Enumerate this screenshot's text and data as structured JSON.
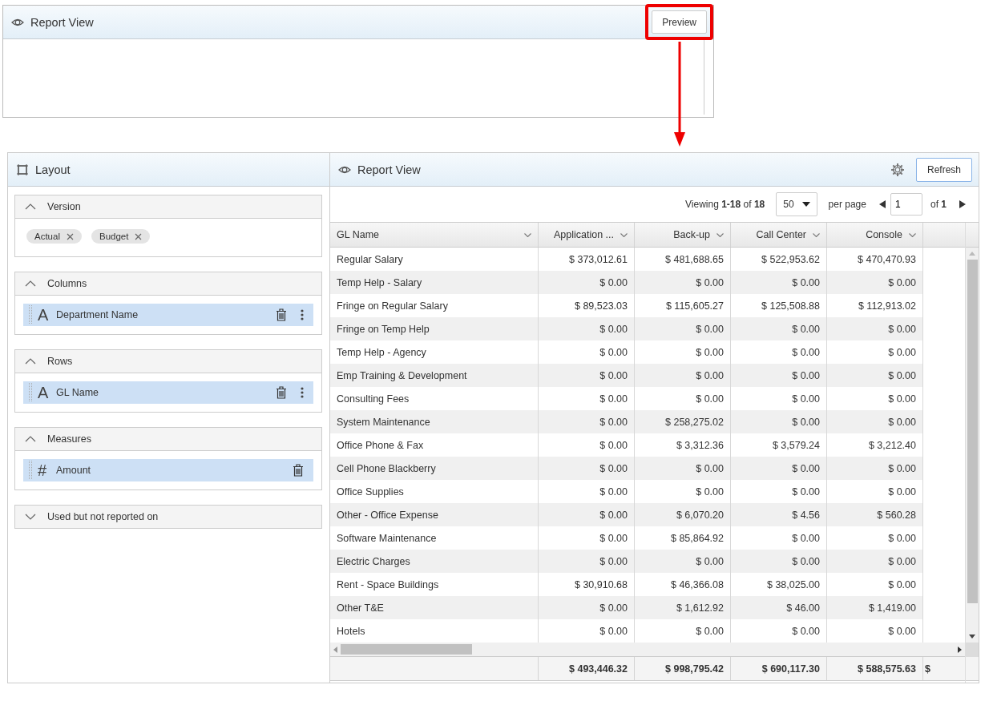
{
  "top_panel": {
    "title": "Report View",
    "button": {
      "label": "Preview",
      "highlighted": true
    }
  },
  "layout_panel": {
    "title": "Layout",
    "sections": [
      {
        "title": "Version",
        "expanded": true,
        "kind": "chips",
        "chips": [
          "Actual",
          "Budget"
        ]
      },
      {
        "title": "Columns",
        "expanded": true,
        "kind": "fields",
        "fields": [
          {
            "glyph": "A",
            "label": "Department Name",
            "menu": true
          }
        ]
      },
      {
        "title": "Rows",
        "expanded": true,
        "kind": "fields",
        "fields": [
          {
            "glyph": "A",
            "label": "GL Name",
            "menu": true
          }
        ]
      },
      {
        "title": "Measures",
        "expanded": true,
        "kind": "fields",
        "fields": [
          {
            "glyph": "#",
            "label": "Amount",
            "menu": false
          }
        ]
      },
      {
        "title": "Used but not reported on",
        "expanded": false
      }
    ]
  },
  "report_panel": {
    "title": "Report View",
    "button": "Refresh",
    "pager": {
      "viewing": "Viewing **1-18** of **18**",
      "page_size": "50",
      "per_page": "per page",
      "page": "1",
      "of": "of **1**"
    },
    "table": {
      "columns": [
        "GL Name",
        "Application ...",
        "Back-up",
        "Call Center",
        "Console"
      ],
      "rows": [
        [
          "Regular Salary",
          "$ 373,012.61",
          "$ 481,688.65",
          "$ 522,953.62",
          "$ 470,470.93"
        ],
        [
          "Temp Help - Salary",
          "$ 0.00",
          "$ 0.00",
          "$ 0.00",
          "$ 0.00"
        ],
        [
          "Fringe on Regular Salary",
          "$ 89,523.03",
          "$ 115,605.27",
          "$ 125,508.88",
          "$ 112,913.02"
        ],
        [
          "Fringe on Temp Help",
          "$ 0.00",
          "$ 0.00",
          "$ 0.00",
          "$ 0.00"
        ],
        [
          "Temp Help - Agency",
          "$ 0.00",
          "$ 0.00",
          "$ 0.00",
          "$ 0.00"
        ],
        [
          "Emp Training & Development",
          "$ 0.00",
          "$ 0.00",
          "$ 0.00",
          "$ 0.00"
        ],
        [
          "Consulting Fees",
          "$ 0.00",
          "$ 0.00",
          "$ 0.00",
          "$ 0.00"
        ],
        [
          "System Maintenance",
          "$ 0.00",
          "$ 258,275.02",
          "$ 0.00",
          "$ 0.00"
        ],
        [
          "Office Phone & Fax",
          "$ 0.00",
          "$ 3,312.36",
          "$ 3,579.24",
          "$ 3,212.40"
        ],
        [
          "Cell Phone Blackberry",
          "$ 0.00",
          "$ 0.00",
          "$ 0.00",
          "$ 0.00"
        ],
        [
          "Office Supplies",
          "$ 0.00",
          "$ 0.00",
          "$ 0.00",
          "$ 0.00"
        ],
        [
          "Other - Office Expense",
          "$ 0.00",
          "$ 6,070.20",
          "$ 4.56",
          "$ 560.28"
        ],
        [
          "Software Maintenance",
          "$ 0.00",
          "$ 85,864.92",
          "$ 0.00",
          "$ 0.00"
        ],
        [
          "Electric Charges",
          "$ 0.00",
          "$ 0.00",
          "$ 0.00",
          "$ 0.00"
        ],
        [
          "Rent - Space Buildings",
          "$ 30,910.68",
          "$ 46,366.08",
          "$ 38,025.00",
          "$ 0.00"
        ],
        [
          "Other T&E",
          "$ 0.00",
          "$ 1,612.92",
          "$ 46.00",
          "$ 1,419.00"
        ],
        [
          "Hotels",
          "$ 0.00",
          "$ 0.00",
          "$ 0.00",
          "$ 0.00"
        ]
      ],
      "totals": [
        "$ 493,446.32",
        "$ 998,795.42",
        "$ 690,117.30",
        "$ 588,575.63",
        "$"
      ]
    }
  }
}
